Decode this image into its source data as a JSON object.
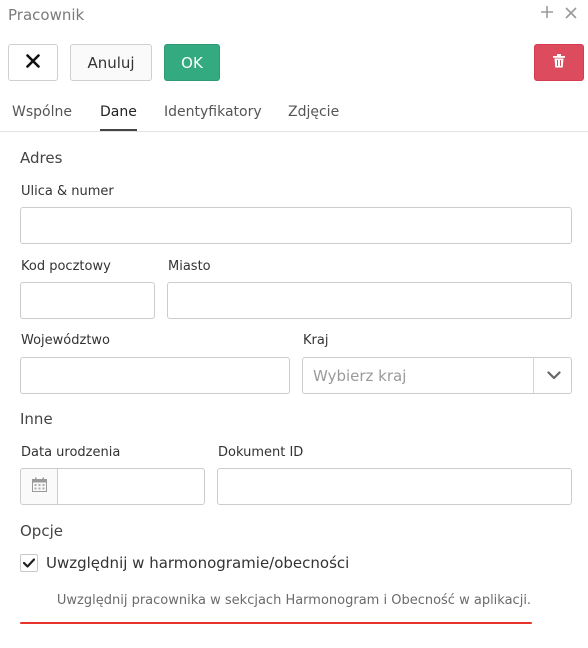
{
  "window": {
    "title": "Pracownik",
    "plus_icon": "plus-icon",
    "close_icon": "close-icon"
  },
  "toolbar": {
    "close_icon": "close-x-icon",
    "cancel_label": "Anuluj",
    "ok_label": "OK",
    "delete_icon": "trash-icon",
    "ok_color": "#33aa80",
    "delete_color": "#dc4b5e"
  },
  "tabs": [
    {
      "label": "Wspólne",
      "active": false
    },
    {
      "label": "Dane",
      "active": true
    },
    {
      "label": "Identyfikatory",
      "active": false
    },
    {
      "label": "Zdjęcie",
      "active": false
    }
  ],
  "address": {
    "section_title": "Adres",
    "street_label": "Ulica & numer",
    "street_value": "",
    "postal_label": "Kod pocztowy",
    "postal_value": "",
    "city_label": "Miasto",
    "city_value": "",
    "province_label": "Województwo",
    "province_value": "",
    "country_label": "Kraj",
    "country_placeholder": "Wybierz kraj"
  },
  "other": {
    "section_title": "Inne",
    "birthdate_label": "Data urodzenia",
    "birthdate_value": "",
    "calendar_icon": "calendar-icon",
    "document_label": "Dokument ID",
    "document_value": ""
  },
  "options": {
    "section_title": "Opcje",
    "include_label": "Uwzględnij w harmonogramie/obecności",
    "include_checked": true,
    "help_text": "Uwzględnij pracownika w sekcjach Harmonogram i Obecność w aplikacji.",
    "underline_color": "#e8322b"
  }
}
